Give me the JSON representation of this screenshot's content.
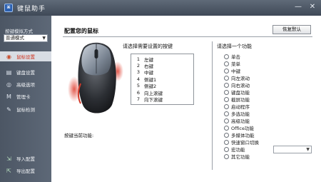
{
  "window": {
    "title": "键鼠助手",
    "icon": "app-logo-icon"
  },
  "window_buttons": {
    "minimize": "—",
    "close": "✕"
  },
  "sidebar": {
    "mode_label": "按键模拟方式",
    "mode_value": "普通模式",
    "items": [
      {
        "label": "鼠标设置",
        "icon": "mouse-icon",
        "active": true
      },
      {
        "label": "键盘设置",
        "icon": "keyboard-icon",
        "active": false
      },
      {
        "label": "高级选项",
        "icon": "advanced-icon",
        "active": false
      },
      {
        "label": "管理卡",
        "icon": "card-icon",
        "active": false
      },
      {
        "label": "鼠标检测",
        "icon": "detect-icon",
        "active": false
      }
    ],
    "bottom": [
      {
        "label": "导入配置",
        "icon": "import-icon"
      },
      {
        "label": "导出配置",
        "icon": "export-icon"
      }
    ]
  },
  "main": {
    "title": "配置您的鼠标",
    "reset_label": "恢复默认",
    "button_prompt": "请选择需要设置的按键",
    "function_prompt": "请选择一个功能",
    "current_function_label": "按键当前功能:",
    "buttons": [
      {
        "num": "1",
        "label": "左键"
      },
      {
        "num": "2",
        "label": "右键"
      },
      {
        "num": "3",
        "label": "中键"
      },
      {
        "num": "4",
        "label": "侧键1"
      },
      {
        "num": "5",
        "label": "侧键2"
      },
      {
        "num": "6",
        "label": "向上滚键"
      },
      {
        "num": "7",
        "label": "向下滚键"
      }
    ],
    "functions": [
      "单击",
      "菜单",
      "中键",
      "向左滚动",
      "向右滚动",
      "键盘功能",
      "截屏功能",
      "启动程序",
      "多选功能",
      "高级功能",
      "Office功能",
      "多媒体功能",
      "快速窗口切换",
      "宏功能",
      "其它功能"
    ],
    "function_select_value": ""
  },
  "colors": {
    "titlebar": "#4f5a68",
    "sidebar": "#535e6c",
    "active_item": "#d8dde4",
    "active_text": "#d0331f",
    "mouse_accent": "#d23a2a"
  }
}
